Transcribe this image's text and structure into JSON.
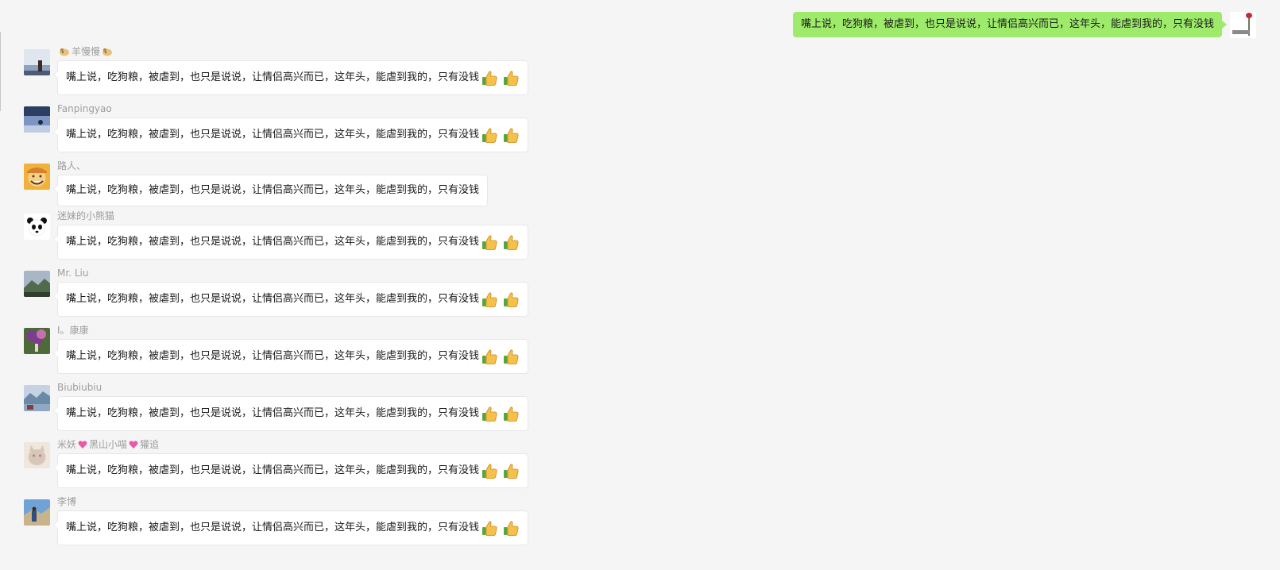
{
  "self_message": {
    "text": "嘴上说，吃狗粮，被虐到，也只是说说，让情侣高兴而已，这年头，能虐到我的，只有没钱",
    "avatar_icon": "rose-avatar-icon",
    "bubble_color": "#9eea6a"
  },
  "messages": [
    {
      "sender": "羊慢慢",
      "sender_prefix_icon": "dog-emoji-icon",
      "sender_suffix_icon": "dog-emoji-icon",
      "text": "嘴上说，吃狗粮，被虐到，也只是说说，让情侣高兴而已，这年头，能虐到我的，只有没钱",
      "thumbs": 2,
      "avatar_icon": "landscape-avatar-icon",
      "avatar_colors": [
        "#dfe6ef",
        "#8ea3bf",
        "#4b5b73"
      ]
    },
    {
      "sender": "Fanpingyao",
      "text": "嘴上说，吃狗粮，被虐到，也只是说说，让情侣高兴而已，这年头，能虐到我的，只有没钱",
      "thumbs": 2,
      "avatar_icon": "sky-avatar-icon",
      "avatar_colors": [
        "#2c3e64",
        "#7d95c2",
        "#bfcde3"
      ]
    },
    {
      "sender": "路人、",
      "text": "嘴上说，吃狗粮，被虐到，也只是说说，让情侣高兴而已，这年头，能虐到我的，只有没钱",
      "thumbs": 0,
      "avatar_icon": "cartoon-face-avatar-icon",
      "avatar_colors": [
        "#f0b23a",
        "#d9802a",
        "#5a3a1a"
      ]
    },
    {
      "sender": "迷妹的小熊猫",
      "text": "嘴上说，吃狗粮，被虐到，也只是说说，让情侣高兴而已，这年头，能虐到我的，只有没钱",
      "thumbs": 2,
      "avatar_icon": "panda-avatar-icon",
      "avatar_colors": [
        "#ffffff",
        "#111111",
        "#111111"
      ]
    },
    {
      "sender": "Mr. Liu",
      "text": "嘴上说，吃狗粮，被虐到，也只是说说，让情侣高兴而已，这年头，能虐到我的，只有没钱",
      "thumbs": 2,
      "avatar_icon": "mountain-avatar-icon",
      "avatar_colors": [
        "#a9b6c6",
        "#4f6a4c",
        "#2e3f2c"
      ]
    },
    {
      "sender": "I。康康",
      "text": "嘴上说，吃狗粮，被虐到，也只是说说，让情侣高兴而已，这年头，能虐到我的，只有没钱",
      "thumbs": 2,
      "avatar_icon": "flowers-avatar-icon",
      "avatar_colors": [
        "#7b3e8c",
        "#c66fb0",
        "#4e6a3a"
      ]
    },
    {
      "sender": "Biubiubiu",
      "text": "嘴上说，吃狗粮，被虐到，也只是说说，让情侣高兴而已，这年头，能虐到我的，只有没钱",
      "thumbs": 2,
      "avatar_icon": "lake-avatar-icon",
      "avatar_colors": [
        "#c4d2e4",
        "#6b8aa8",
        "#8c3a3a"
      ]
    },
    {
      "sender": "米妖",
      "sender_mid": "黑山小喵",
      "sender_tail": "獾追",
      "text": "嘴上说，吃狗粮，被虐到，也只是说说，让情侣高兴而已，这年头，能虐到我的，只有没钱",
      "thumbs": 2,
      "avatar_icon": "cat-avatar-icon",
      "avatar_colors": [
        "#efe6de",
        "#d8c7b8",
        "#a88f7c"
      ]
    },
    {
      "sender": "李博",
      "text": "嘴上说，吃狗粮，被虐到，也只是说说，让情侣高兴而已，这年头，能虐到我的，只有没钱",
      "thumbs": 2,
      "avatar_icon": "person-outdoor-avatar-icon",
      "avatar_colors": [
        "#6fa3d8",
        "#2f4f7f",
        "#c9b38a"
      ]
    }
  ],
  "thumb_icon": "thumbs-up-icon"
}
